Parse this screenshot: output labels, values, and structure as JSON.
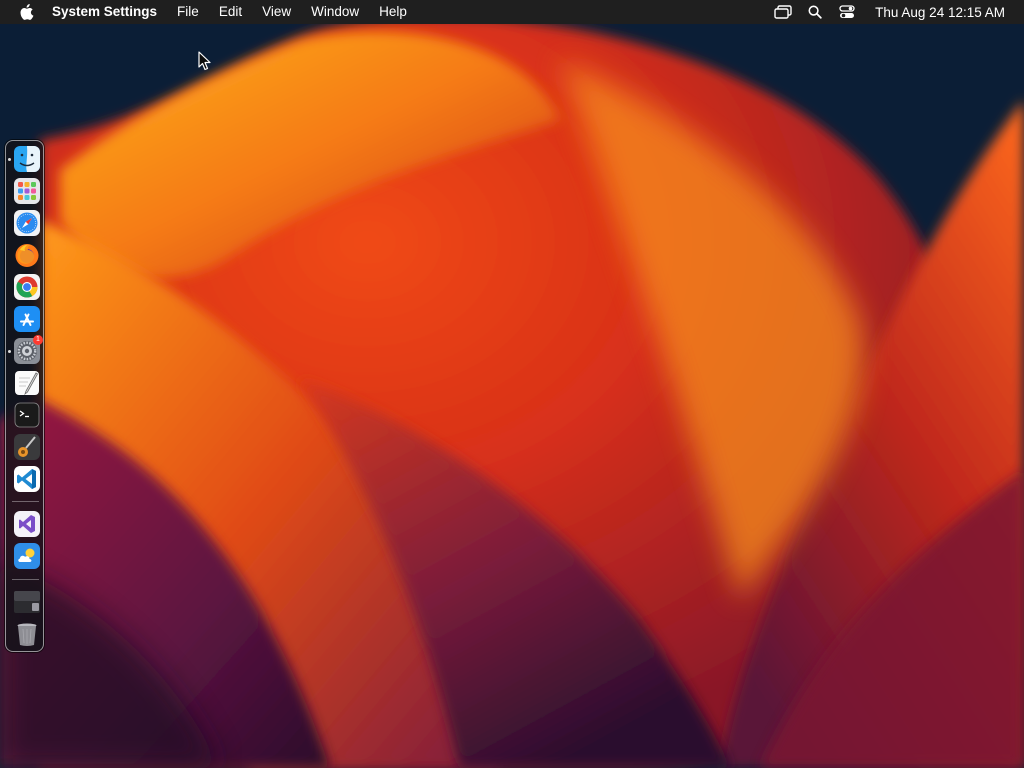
{
  "menubar": {
    "apple_icon": "apple-logo-icon",
    "app_name": "System Settings",
    "menus": [
      "File",
      "Edit",
      "View",
      "Window",
      "Help"
    ],
    "status_icons": [
      "screen-mirroring-icon",
      "spotlight-search-icon",
      "control-center-icon"
    ],
    "clock": "Thu Aug 24  12:15 AM"
  },
  "dock": {
    "apps": [
      {
        "name": "Finder",
        "icon": "finder-icon",
        "running": true
      },
      {
        "name": "Launchpad",
        "icon": "launchpad-icon",
        "running": false
      },
      {
        "name": "Safari",
        "icon": "safari-icon",
        "running": false
      },
      {
        "name": "Firefox",
        "icon": "firefox-icon",
        "running": false
      },
      {
        "name": "Google Chrome",
        "icon": "chrome-icon",
        "running": false
      },
      {
        "name": "App Store",
        "icon": "app-store-icon",
        "running": false
      },
      {
        "name": "System Settings",
        "icon": "system-settings-icon",
        "running": true,
        "badge": "1"
      },
      {
        "name": "TextEdit",
        "icon": "textedit-icon",
        "running": false
      },
      {
        "name": "Terminal",
        "icon": "terminal-icon",
        "running": false
      },
      {
        "name": "Instruments",
        "icon": "instruments-icon",
        "running": false
      },
      {
        "name": "Visual Studio Code",
        "icon": "vscode-icon",
        "running": false
      }
    ],
    "recent_apps": [
      {
        "name": "Visual Studio",
        "icon": "visual-studio-icon"
      },
      {
        "name": "Weather",
        "icon": "weather-icon"
      }
    ],
    "stacks": [
      {
        "name": "Downloads",
        "icon": "downloads-stack-icon"
      },
      {
        "name": "Trash",
        "icon": "trash-icon"
      }
    ]
  },
  "colors": {
    "menubar_bg": "#1f1f1f",
    "wallpaper_base": "#0b1e36",
    "wallpaper_orange": "#f5861c",
    "wallpaper_red": "#c8281a",
    "wallpaper_purple": "#6a1a4a"
  }
}
